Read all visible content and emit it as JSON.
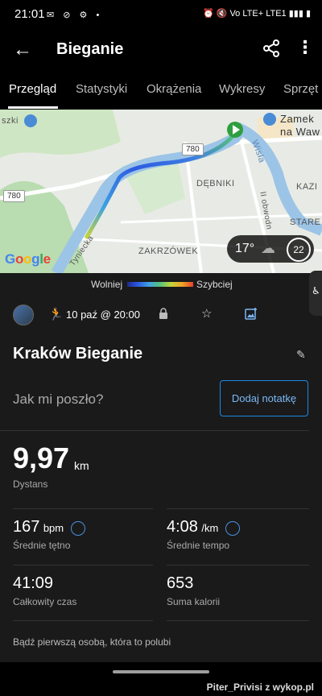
{
  "status": {
    "time": "21:01",
    "network": "Vo LTE+ LTE1"
  },
  "appbar": {
    "back_icon": "arrow-left-icon",
    "title": "Bieganie"
  },
  "tabs": [
    {
      "label": "Przegląd",
      "active": true
    },
    {
      "label": "Statystyki"
    },
    {
      "label": "Okrążenia"
    },
    {
      "label": "Wykresy"
    },
    {
      "label": "Sprzęt"
    }
  ],
  "map": {
    "labels": {
      "zamek": "Zamek",
      "na_waw": "na Waw",
      "dębniki": "DĘBNIKI",
      "zakrzówek": "ZAKRZÓWEK",
      "kazi": "KAZI",
      "stare": "STARE",
      "wisla": "Wisła",
      "obwodnica": "II obwodn",
      "tyniecka": "Tyniecka",
      "szki": "szki"
    },
    "roads": [
      "780",
      "780"
    ],
    "temperature": "17°",
    "aqi": "22",
    "google": "Google"
  },
  "legend": {
    "slow": "Wolniej",
    "fast": "Szybciej"
  },
  "activity": {
    "date": "10 paź @ 20:00",
    "name": "Kraków Bieganie",
    "how_prompt": "Jak mi poszło?",
    "add_note": "Dodaj notatkę",
    "distance": {
      "value": "9,97",
      "unit": "km",
      "label": "Dystans"
    },
    "heart_rate": {
      "value": "167",
      "unit": "bpm",
      "label": "Średnie tętno"
    },
    "pace": {
      "value": "4:08",
      "unit": "/km",
      "label": "Średnie tempo"
    },
    "time": {
      "value": "41:09",
      "label": "Całkowity czas"
    },
    "calories": {
      "value": "653",
      "label": "Suma kalorii"
    },
    "like_prompt": "Bądź pierwszą osobą, która to polubi"
  },
  "watermark": "Piter_Privisi z wykop.pl",
  "colors": {
    "accent": "#1e88e5",
    "background": "#1a1a1a"
  }
}
